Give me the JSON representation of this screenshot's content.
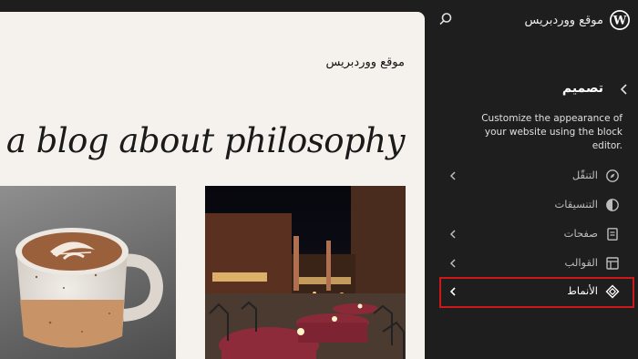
{
  "topbar": {
    "site_name": "موقع ووردبريس"
  },
  "preview": {
    "site_title": "موقع ووردبريس",
    "tagline": "down: a blog about philosophy",
    "images": [
      "coffee-cup-photo",
      "night-piazza-photo"
    ]
  },
  "sidebar": {
    "heading": "تصميم",
    "description": "Customize the appearance of your website using the block editor.",
    "items": [
      {
        "label": "التنقّل",
        "icon": "navigation-compass-icon",
        "has_chevron": true
      },
      {
        "label": "التنسيقات",
        "icon": "styles-contrast-icon",
        "has_chevron": false
      },
      {
        "label": "صفحات",
        "icon": "pages-icon",
        "has_chevron": true
      },
      {
        "label": "القوالب",
        "icon": "templates-layout-icon",
        "has_chevron": true
      },
      {
        "label": "الأنماط",
        "icon": "patterns-diamond-icon",
        "has_chevron": true,
        "highlighted": true
      }
    ]
  },
  "colors": {
    "sidebar_bg": "#1e1e1e",
    "canvas_bg": "#f5f2ed",
    "highlight_border": "#cc1818"
  }
}
